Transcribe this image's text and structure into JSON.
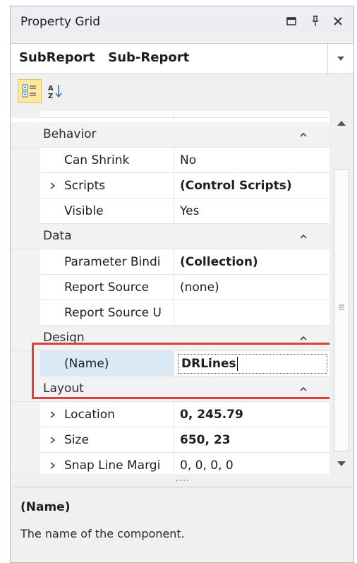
{
  "window": {
    "title": "Property Grid",
    "icons": [
      "maximize-icon",
      "pin-icon",
      "close-icon"
    ]
  },
  "selector": {
    "text": "SubReport   Sub-Report"
  },
  "toolbar": {
    "categorized_icon": "categorized-view-icon",
    "alphabetical_icon": "alphabetical-sort-icon"
  },
  "grid": {
    "categories": {
      "behavior": "Behavior",
      "data": "Data",
      "design": "Design",
      "layout": "Layout"
    },
    "rows": {
      "can_shrink": {
        "name": "Can Shrink",
        "value": "No"
      },
      "scripts": {
        "name": "Scripts",
        "value": "(Control Scripts)"
      },
      "visible": {
        "name": "Visible",
        "value": "Yes"
      },
      "parameter_bindings": {
        "name": "Parameter Bindi",
        "value": "(Collection)"
      },
      "report_source": {
        "name": "Report Source",
        "value": "(none)"
      },
      "report_source_url": {
        "name": "Report Source U",
        "value": ""
      },
      "name": {
        "name": "(Name)",
        "value": "DRLines"
      },
      "location": {
        "name": "Location",
        "value": "0, 245.79"
      },
      "size": {
        "name": "Size",
        "value": "650, 23"
      },
      "snap_line_margin": {
        "name": "Snap Line Margi",
        "value": "0, 0, 0, 0"
      }
    }
  },
  "description": {
    "title": "(Name)",
    "text": "The name of the component."
  },
  "colors": {
    "highlight": "#e0403a",
    "selected_row": "#dbe9f7",
    "active_tool": "#fce99b"
  }
}
